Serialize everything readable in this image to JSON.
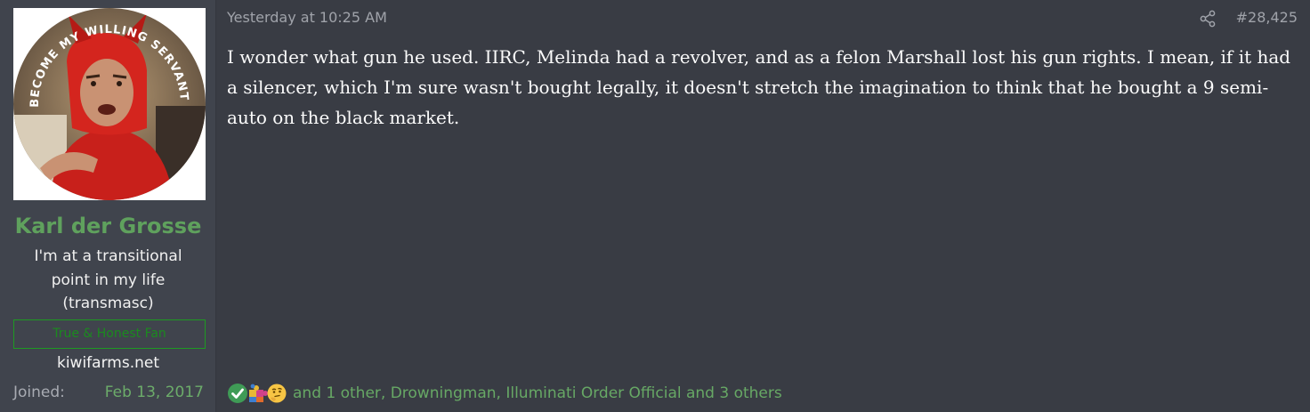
{
  "user": {
    "avatar_caption": "BECOME MY WILLING SERVANT!",
    "username": "Karl der Grosse",
    "title_lines": [
      "I'm at a transitional",
      "point in my life",
      "(transmasc)"
    ],
    "banner": "True & Honest Fan",
    "site": "kiwifarms.net",
    "joined_label": "Joined:",
    "joined_value": "Feb 13, 2017"
  },
  "post": {
    "date": "Yesterday at 10:25 AM",
    "number": "#28,425",
    "message": "I wonder what gun he used. IIRC, Melinda had a revolver, and as a felon Marshall lost his gun rights. I mean, if it had a silencer, which I'm sure wasn't bought legally, it doesn't stretch the imagination to think that he bought a 9 semi-auto on the black market."
  },
  "reactions": {
    "icons": [
      "check-reaction-icon",
      "puzzle-reaction-icon",
      "thinking-reaction-icon"
    ],
    "summary": "and 1 other, Drowningman, Illuminati Order Official and 3 others"
  },
  "colors": {
    "username": "#5fa15d",
    "banner": "#1b8a1f",
    "joined_value": "#6cac6a",
    "reaction_text": "#67a865"
  }
}
